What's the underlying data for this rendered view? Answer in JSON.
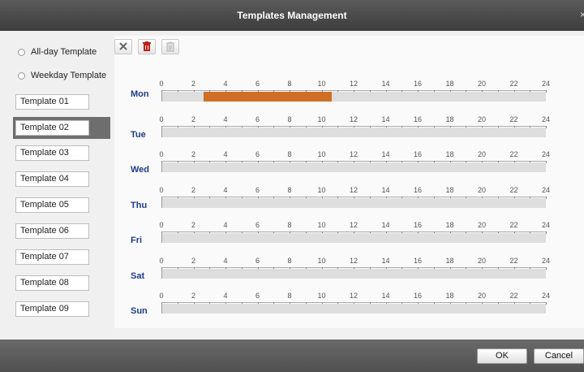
{
  "window": {
    "title": "Templates Management"
  },
  "sidebar": {
    "radios": [
      {
        "label": "All-day Template"
      },
      {
        "label": "Weekday Template"
      }
    ],
    "templates": [
      {
        "label": "Template 01"
      },
      {
        "label": "Template 02"
      },
      {
        "label": "Template 03"
      },
      {
        "label": "Template 04"
      },
      {
        "label": "Template 05"
      },
      {
        "label": "Template 06"
      },
      {
        "label": "Template 07"
      },
      {
        "label": "Template 08"
      },
      {
        "label": "Template 09"
      }
    ],
    "selected_template": "Template 02"
  },
  "toolbar": {
    "icons": [
      "erase-icon",
      "delete-icon",
      "copy-icon"
    ]
  },
  "schedule": {
    "hour_ticks": [
      "0",
      "2",
      "4",
      "6",
      "8",
      "10",
      "12",
      "14",
      "16",
      "18",
      "20",
      "22",
      "24"
    ],
    "days": [
      {
        "label": "Mon",
        "segments": [
          {
            "start_hour": 2.6,
            "end_hour": 10.6
          }
        ]
      },
      {
        "label": "Tue",
        "segments": []
      },
      {
        "label": "Wed",
        "segments": []
      },
      {
        "label": "Thu",
        "segments": []
      },
      {
        "label": "Fri",
        "segments": []
      },
      {
        "label": "Sat",
        "segments": []
      },
      {
        "label": "Sun",
        "segments": []
      }
    ],
    "segment_color": "#cf6f25"
  },
  "footer": {
    "ok_label": "OK",
    "cancel_label": "Cancel"
  }
}
